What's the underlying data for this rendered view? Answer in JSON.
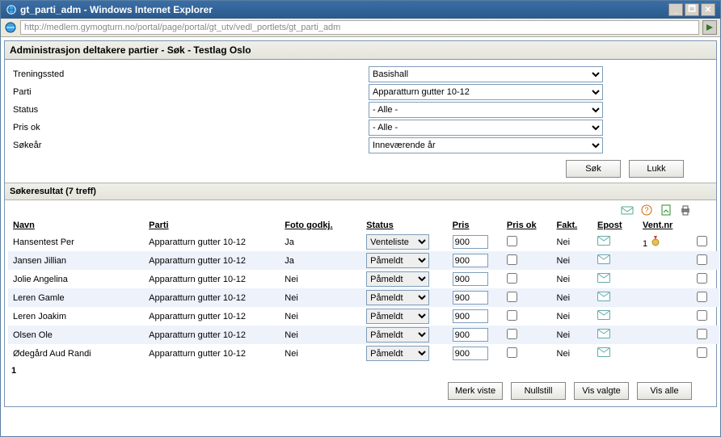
{
  "window": {
    "title": "gt_parti_adm - Windows Internet Explorer"
  },
  "address": {
    "url": "http://medlem.gymogturn.no/portal/page/portal/gt_utv/vedl_portlets/gt_parti_adm"
  },
  "panel": {
    "title": "Administrasjon deltakere partier - Søk - Testlag Oslo"
  },
  "filters": {
    "treningssted": {
      "label": "Treningssted",
      "value": "Basishall"
    },
    "parti": {
      "label": "Parti",
      "value": "Apparatturn gutter 10-12"
    },
    "status": {
      "label": "Status",
      "value": "- Alle -"
    },
    "prisok": {
      "label": "Pris ok",
      "value": "- Alle -"
    },
    "sokeår": {
      "label": "Søkeår",
      "value": "Inneværende år"
    }
  },
  "buttons": {
    "sok": "Søk",
    "lukk": "Lukk",
    "merk_viste": "Merk viste",
    "nullstill": "Nullstill",
    "vis_valgte": "Vis valgte",
    "vis_alle": "Vis alle"
  },
  "results_header": "Søkeresultat (7 treff)",
  "columns": {
    "navn": "Navn",
    "parti": "Parti",
    "foto": "Foto godkj.",
    "status": "Status",
    "pris": "Pris",
    "prisok": "Pris ok",
    "fakt": "Fakt.",
    "epost": "Epost",
    "ventnr": "Vent.nr"
  },
  "status_options": {
    "venteliste": "Venteliste",
    "pameldt": "Påmeldt"
  },
  "rows": [
    {
      "navn": "Hansentest Per",
      "parti": "Apparatturn gutter 10-12",
      "foto": "Ja",
      "status": "Venteliste",
      "pris": "900",
      "fakt": "Nei",
      "ventnr": "1"
    },
    {
      "navn": "Jansen Jillian",
      "parti": "Apparatturn gutter 10-12",
      "foto": "Ja",
      "status": "Påmeldt",
      "pris": "900",
      "fakt": "Nei",
      "ventnr": ""
    },
    {
      "navn": "Jolie Angelina",
      "parti": "Apparatturn gutter 10-12",
      "foto": "Nei",
      "status": "Påmeldt",
      "pris": "900",
      "fakt": "Nei",
      "ventnr": ""
    },
    {
      "navn": "Leren Gamle",
      "parti": "Apparatturn gutter 10-12",
      "foto": "Nei",
      "status": "Påmeldt",
      "pris": "900",
      "fakt": "Nei",
      "ventnr": ""
    },
    {
      "navn": "Leren Joakim",
      "parti": "Apparatturn gutter 10-12",
      "foto": "Nei",
      "status": "Påmeldt",
      "pris": "900",
      "fakt": "Nei",
      "ventnr": ""
    },
    {
      "navn": "Olsen Ole",
      "parti": "Apparatturn gutter 10-12",
      "foto": "Nei",
      "status": "Påmeldt",
      "pris": "900",
      "fakt": "Nei",
      "ventnr": ""
    },
    {
      "navn": "Ødegård Aud Randi",
      "parti": "Apparatturn gutter 10-12",
      "foto": "Nei",
      "status": "Påmeldt",
      "pris": "900",
      "fakt": "Nei",
      "ventnr": ""
    }
  ],
  "page_number": "1"
}
